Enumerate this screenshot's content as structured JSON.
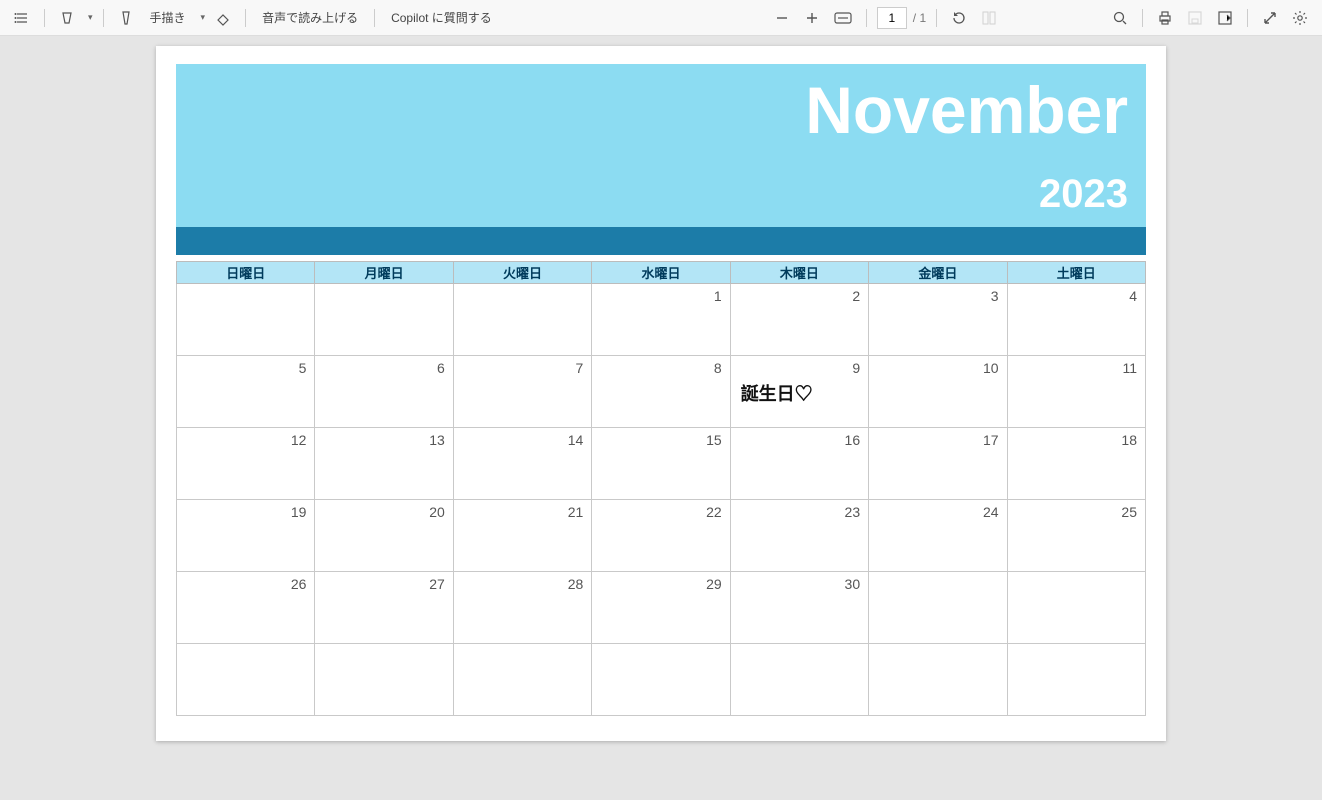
{
  "toolbar": {
    "draw_label": "手描き",
    "read_aloud_label": "音声で読み上げる",
    "copilot_label": "Copilot に質問する",
    "page_input_value": "1",
    "page_total": "/ 1"
  },
  "calendar": {
    "month": "November",
    "year": "2023",
    "weekdays": [
      "日曜日",
      "月曜日",
      "火曜日",
      "水曜日",
      "木曜日",
      "金曜日",
      "土曜日"
    ],
    "weeks": [
      [
        "",
        "",
        "1",
        "2",
        "3",
        "4",
        ""
      ],
      [
        "5",
        "6",
        "7",
        "8",
        "9",
        "10",
        "11"
      ],
      [
        "12",
        "13",
        "14",
        "15",
        "16",
        "17",
        "18"
      ],
      [
        "19",
        "20",
        "21",
        "22",
        "23",
        "24",
        "25"
      ],
      [
        "26",
        "27",
        "28",
        "29",
        "30",
        "",
        ""
      ],
      [
        "",
        "",
        "",
        "",
        "",
        "",
        ""
      ]
    ],
    "row1": [
      "",
      "",
      "",
      "1",
      "2",
      "3",
      "4"
    ],
    "row2": [
      "5",
      "6",
      "7",
      "8",
      "9",
      "10",
      "11"
    ],
    "row3": [
      "12",
      "13",
      "14",
      "15",
      "16",
      "17",
      "18"
    ],
    "row4": [
      "19",
      "20",
      "21",
      "22",
      "23",
      "24",
      "25"
    ],
    "row5": [
      "26",
      "27",
      "28",
      "29",
      "30",
      "",
      ""
    ],
    "row6": [
      "",
      "",
      "",
      "",
      "",
      "",
      ""
    ],
    "annotation": "誕生日♡"
  }
}
